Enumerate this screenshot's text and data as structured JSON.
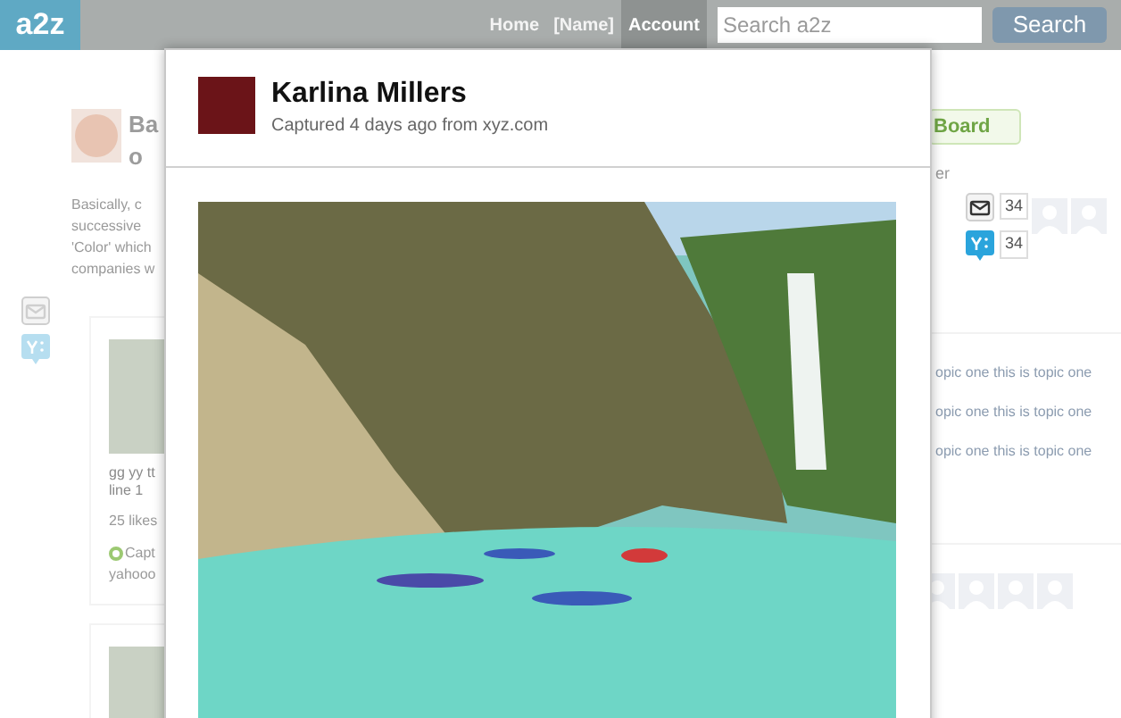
{
  "nav": {
    "logo": "a2z",
    "links": [
      {
        "label": "Home",
        "selected": false
      },
      {
        "label": "[Name]",
        "selected": false
      },
      {
        "label": "Account",
        "selected": true
      }
    ],
    "search": {
      "placeholder": "Search a2z"
    },
    "search_button": "Search"
  },
  "background": {
    "title_lines": [
      "Ba",
      "o"
    ],
    "board_button": "Board",
    "description_lines": [
      "Basically, c",
      "successive",
      "'Color' which",
      "companies w"
    ],
    "card": {
      "title_lines": [
        "gg yy tt",
        "line 1"
      ],
      "likes": "25 likes",
      "source": "Capt",
      "source_site": "yahooo"
    },
    "sidebar": {
      "heading": "er",
      "share_counts": [
        {
          "kind": "mail",
          "count": "34"
        },
        {
          "kind": "yahoo",
          "count": "34"
        }
      ],
      "topics": [
        "opic one this is topic one",
        "opic one this is topic one",
        "opic one this is topic one"
      ]
    }
  },
  "modal": {
    "name": "Karlina Millers",
    "subtitle": "Captured 4 days ago from xyz.com"
  }
}
